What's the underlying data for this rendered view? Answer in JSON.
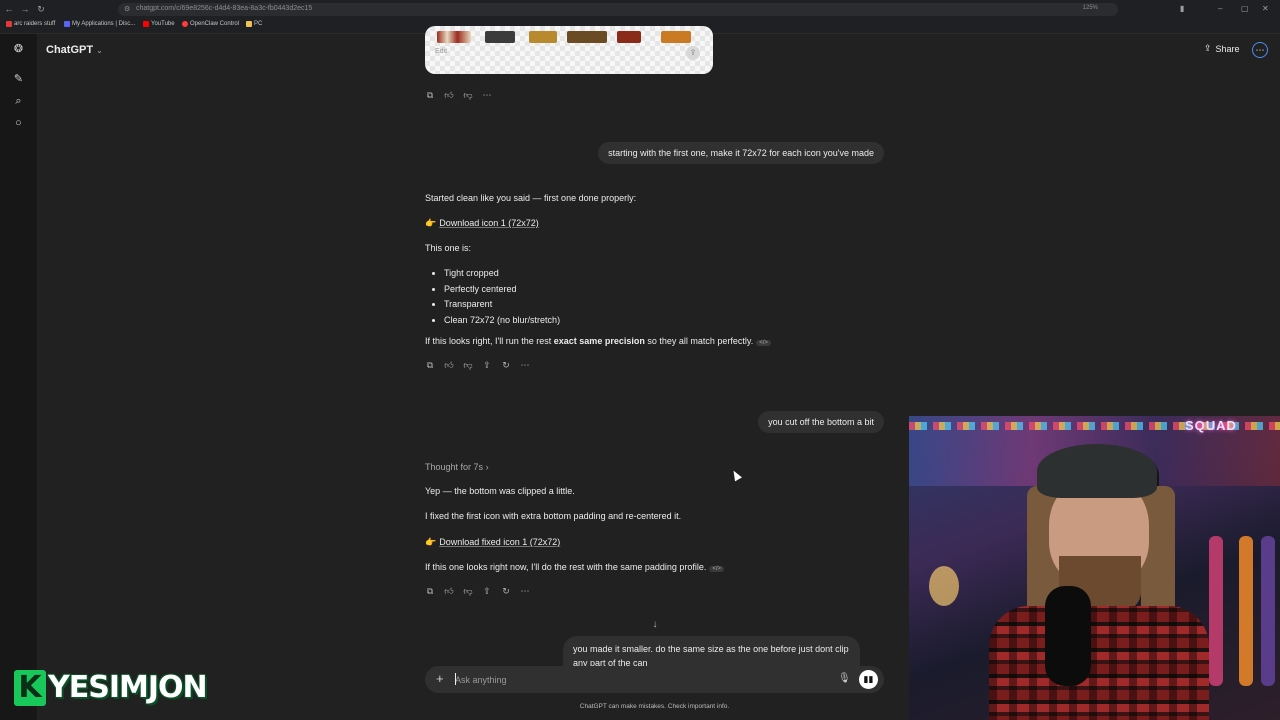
{
  "browser": {
    "url": "chatgpt.com/c/69e8256c-d4d4-83ea-8a3c-fb0443d2ec15",
    "zoom": "125%",
    "bookmarks": [
      "arc raiders stuff",
      "My Applications | Disc...",
      "YouTube",
      "OpenClaw Control",
      "PC"
    ]
  },
  "header": {
    "title": "ChatGPT",
    "share_label": "Share"
  },
  "image_card": {
    "edit_label": "Edit"
  },
  "messages": {
    "user1": "starting with the first one, make it 72x72 for each icon you've made",
    "a1_intro": "Started clean like you said — first one done properly:",
    "a1_link": "Download icon 1 (72x72)",
    "a1_this": "This one is:",
    "a1_bullets": [
      "Tight cropped",
      "Perfectly centered",
      "Transparent",
      "Clean 72x72 (no blur/stretch)"
    ],
    "a1_outro_pre": "If this looks right, I'll run the rest ",
    "a1_outro_bold": "exact same precision",
    "a1_outro_post": " so they all match perfectly.",
    "user2": "you cut off the bottom a bit",
    "thought": "Thought for 7s",
    "a2_line1": "Yep — the bottom was clipped a little.",
    "a2_line2": "I fixed the first icon with extra bottom padding and re-centered it.",
    "a2_link": "Download fixed icon 1 (72x72)",
    "a2_outro": "If this one looks right now, I'll do the rest with the same padding profile.",
    "user3": "you made it smaller. do the same size as the one before just dont clip any part of the can"
  },
  "composer": {
    "placeholder": "Ask anything",
    "disclaimer": "ChatGPT can make mistakes. Check important info."
  },
  "overlay": {
    "logo_letter": "K",
    "logo_name": "YESIMJON",
    "webcam_sign": "SQUAD"
  },
  "colors": {
    "background": "#212121",
    "bubble": "#303030",
    "logo_green": "#19c85b"
  }
}
